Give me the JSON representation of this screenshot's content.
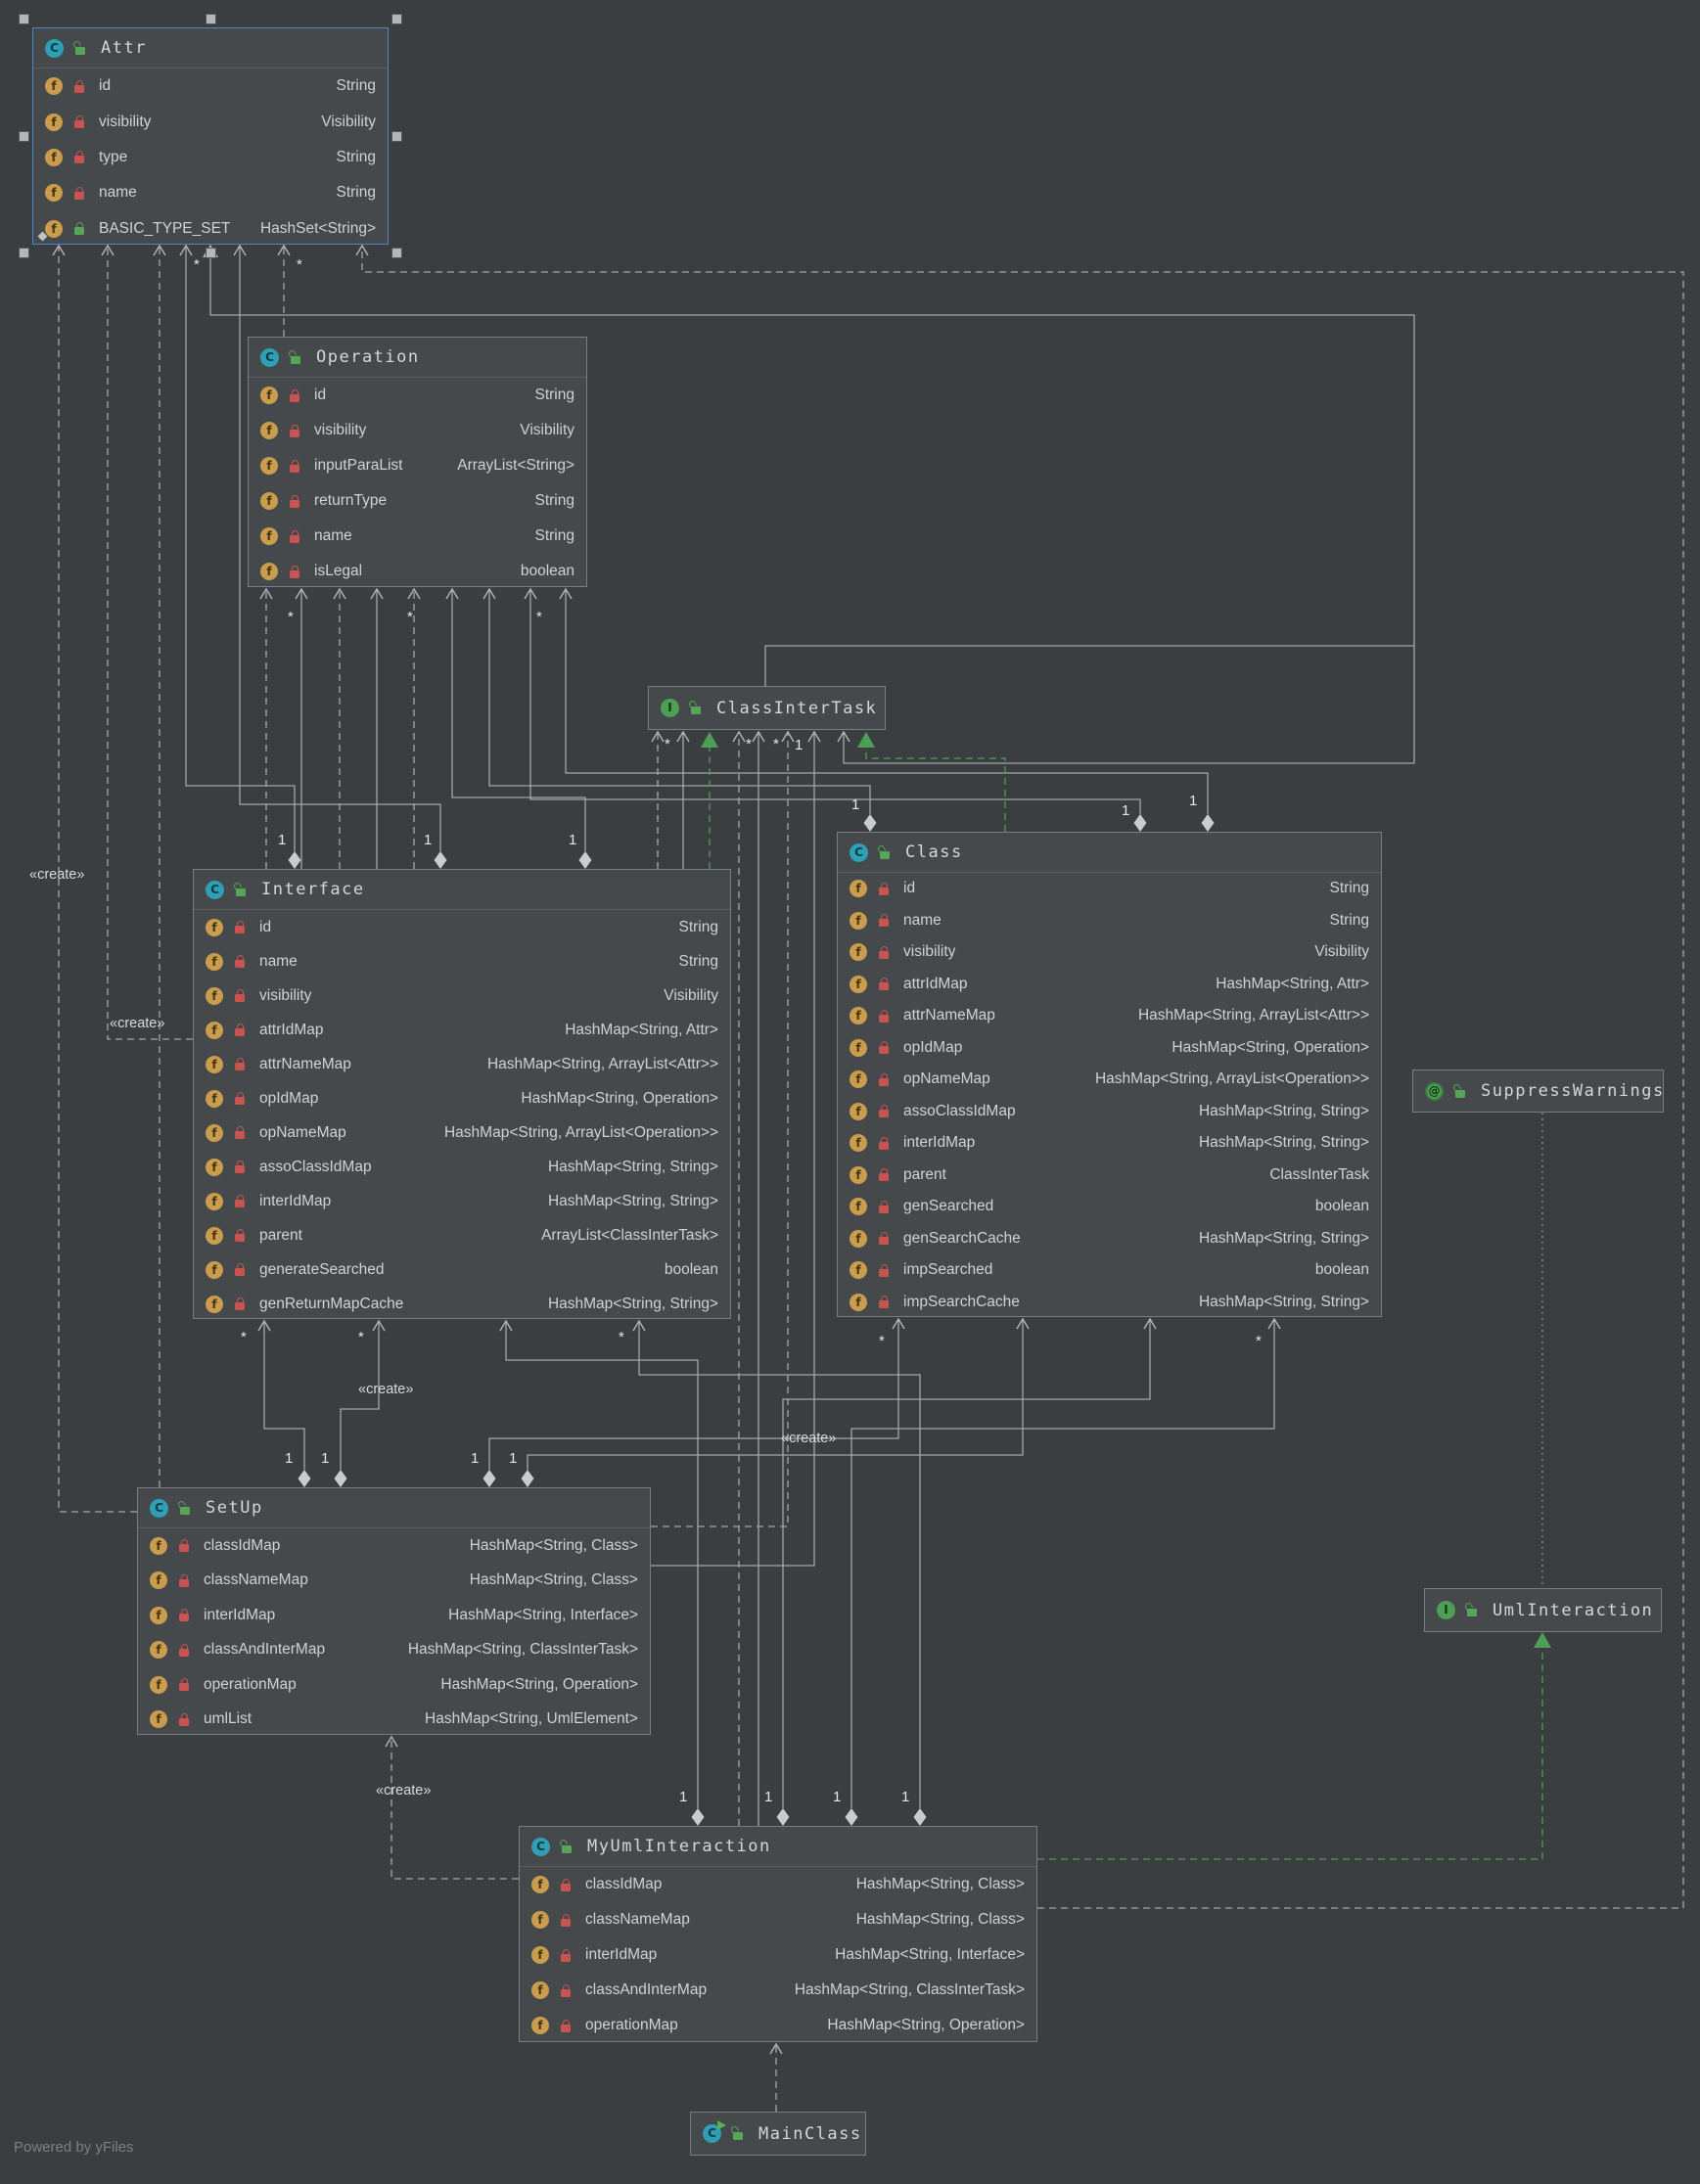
{
  "labels": {
    "create": "«create»",
    "one": "1",
    "many": "*",
    "field_icon": "f"
  },
  "watermark": "Powered by yFiles",
  "colors": {
    "canvas": "#3b3e40",
    "node_bg": "#46494b",
    "node_border": "#7a7d7f",
    "selection": "#4f86c6",
    "edge_grey": "#a4a6a8",
    "edge_green": "#4f9e55",
    "class_icon": "#2f9fb6",
    "interface_icon": "#4f9e55",
    "field_icon": "#c99c4e",
    "lock_locked": "#c75450",
    "lock_unlocked": "#57a559"
  },
  "nodes": {
    "attr": {
      "kind": "class",
      "icon": "C",
      "title": "Attr",
      "fields": [
        {
          "name": "id",
          "type": "String"
        },
        {
          "name": "visibility",
          "type": "Visibility"
        },
        {
          "name": "type",
          "type": "String"
        },
        {
          "name": "name",
          "type": "String"
        },
        {
          "name": "BASIC_TYPE_SET",
          "type": "HashSet<String>",
          "static": true
        }
      ]
    },
    "operation": {
      "kind": "class",
      "icon": "C",
      "title": "Operation",
      "fields": [
        {
          "name": "id",
          "type": "String"
        },
        {
          "name": "visibility",
          "type": "Visibility"
        },
        {
          "name": "inputParaList",
          "type": "ArrayList<String>"
        },
        {
          "name": "returnType",
          "type": "String"
        },
        {
          "name": "name",
          "type": "String"
        },
        {
          "name": "isLegal",
          "type": "boolean"
        }
      ]
    },
    "classintertask": {
      "kind": "interface",
      "icon": "I",
      "title": "ClassInterTask",
      "fields": []
    },
    "interface": {
      "kind": "class",
      "icon": "C",
      "title": "Interface",
      "fields": [
        {
          "name": "id",
          "type": "String"
        },
        {
          "name": "name",
          "type": "String"
        },
        {
          "name": "visibility",
          "type": "Visibility"
        },
        {
          "name": "attrIdMap",
          "type": "HashMap<String, Attr>"
        },
        {
          "name": "attrNameMap",
          "type": "HashMap<String, ArrayList<Attr>>"
        },
        {
          "name": "opIdMap",
          "type": "HashMap<String, Operation>"
        },
        {
          "name": "opNameMap",
          "type": "HashMap<String, ArrayList<Operation>>"
        },
        {
          "name": "assoClassIdMap",
          "type": "HashMap<String, String>"
        },
        {
          "name": "interIdMap",
          "type": "HashMap<String, String>"
        },
        {
          "name": "parent",
          "type": "ArrayList<ClassInterTask>"
        },
        {
          "name": "generateSearched",
          "type": "boolean"
        },
        {
          "name": "genReturnMapCache",
          "type": "HashMap<String, String>"
        }
      ]
    },
    "class": {
      "kind": "class",
      "icon": "C",
      "title": "Class",
      "fields": [
        {
          "name": "id",
          "type": "String"
        },
        {
          "name": "name",
          "type": "String"
        },
        {
          "name": "visibility",
          "type": "Visibility"
        },
        {
          "name": "attrIdMap",
          "type": "HashMap<String, Attr>"
        },
        {
          "name": "attrNameMap",
          "type": "HashMap<String, ArrayList<Attr>>"
        },
        {
          "name": "opIdMap",
          "type": "HashMap<String, Operation>"
        },
        {
          "name": "opNameMap",
          "type": "HashMap<String, ArrayList<Operation>>"
        },
        {
          "name": "assoClassIdMap",
          "type": "HashMap<String, String>"
        },
        {
          "name": "interIdMap",
          "type": "HashMap<String, String>"
        },
        {
          "name": "parent",
          "type": "ClassInterTask"
        },
        {
          "name": "genSearched",
          "type": "boolean"
        },
        {
          "name": "genSearchCache",
          "type": "HashMap<String, String>"
        },
        {
          "name": "impSearched",
          "type": "boolean"
        },
        {
          "name": "impSearchCache",
          "type": "HashMap<String, String>"
        }
      ]
    },
    "setup": {
      "kind": "class",
      "icon": "C",
      "title": "SetUp",
      "fields": [
        {
          "name": "classIdMap",
          "type": "HashMap<String, Class>"
        },
        {
          "name": "classNameMap",
          "type": "HashMap<String, Class>"
        },
        {
          "name": "interIdMap",
          "type": "HashMap<String, Interface>"
        },
        {
          "name": "classAndInterMap",
          "type": "HashMap<String, ClassInterTask>"
        },
        {
          "name": "operationMap",
          "type": "HashMap<String, Operation>"
        },
        {
          "name": "umlList",
          "type": "HashMap<String, UmlElement>"
        }
      ]
    },
    "myumlinteraction": {
      "kind": "class",
      "icon": "C",
      "title": "MyUmlInteraction",
      "fields": [
        {
          "name": "classIdMap",
          "type": "HashMap<String, Class>"
        },
        {
          "name": "classNameMap",
          "type": "HashMap<String, Class>"
        },
        {
          "name": "interIdMap",
          "type": "HashMap<String, Interface>"
        },
        {
          "name": "classAndInterMap",
          "type": "HashMap<String, ClassInterTask>"
        },
        {
          "name": "operationMap",
          "type": "HashMap<String, Operation>"
        }
      ]
    },
    "suppresswarnings": {
      "kind": "annotation",
      "icon": "@",
      "title": "SuppressWarnings",
      "fields": []
    },
    "umlinteraction": {
      "kind": "interface",
      "icon": "I",
      "title": "UmlInteraction",
      "fields": []
    },
    "mainclass": {
      "kind": "runnable-class",
      "icon": "C",
      "title": "MainClass",
      "fields": []
    }
  }
}
